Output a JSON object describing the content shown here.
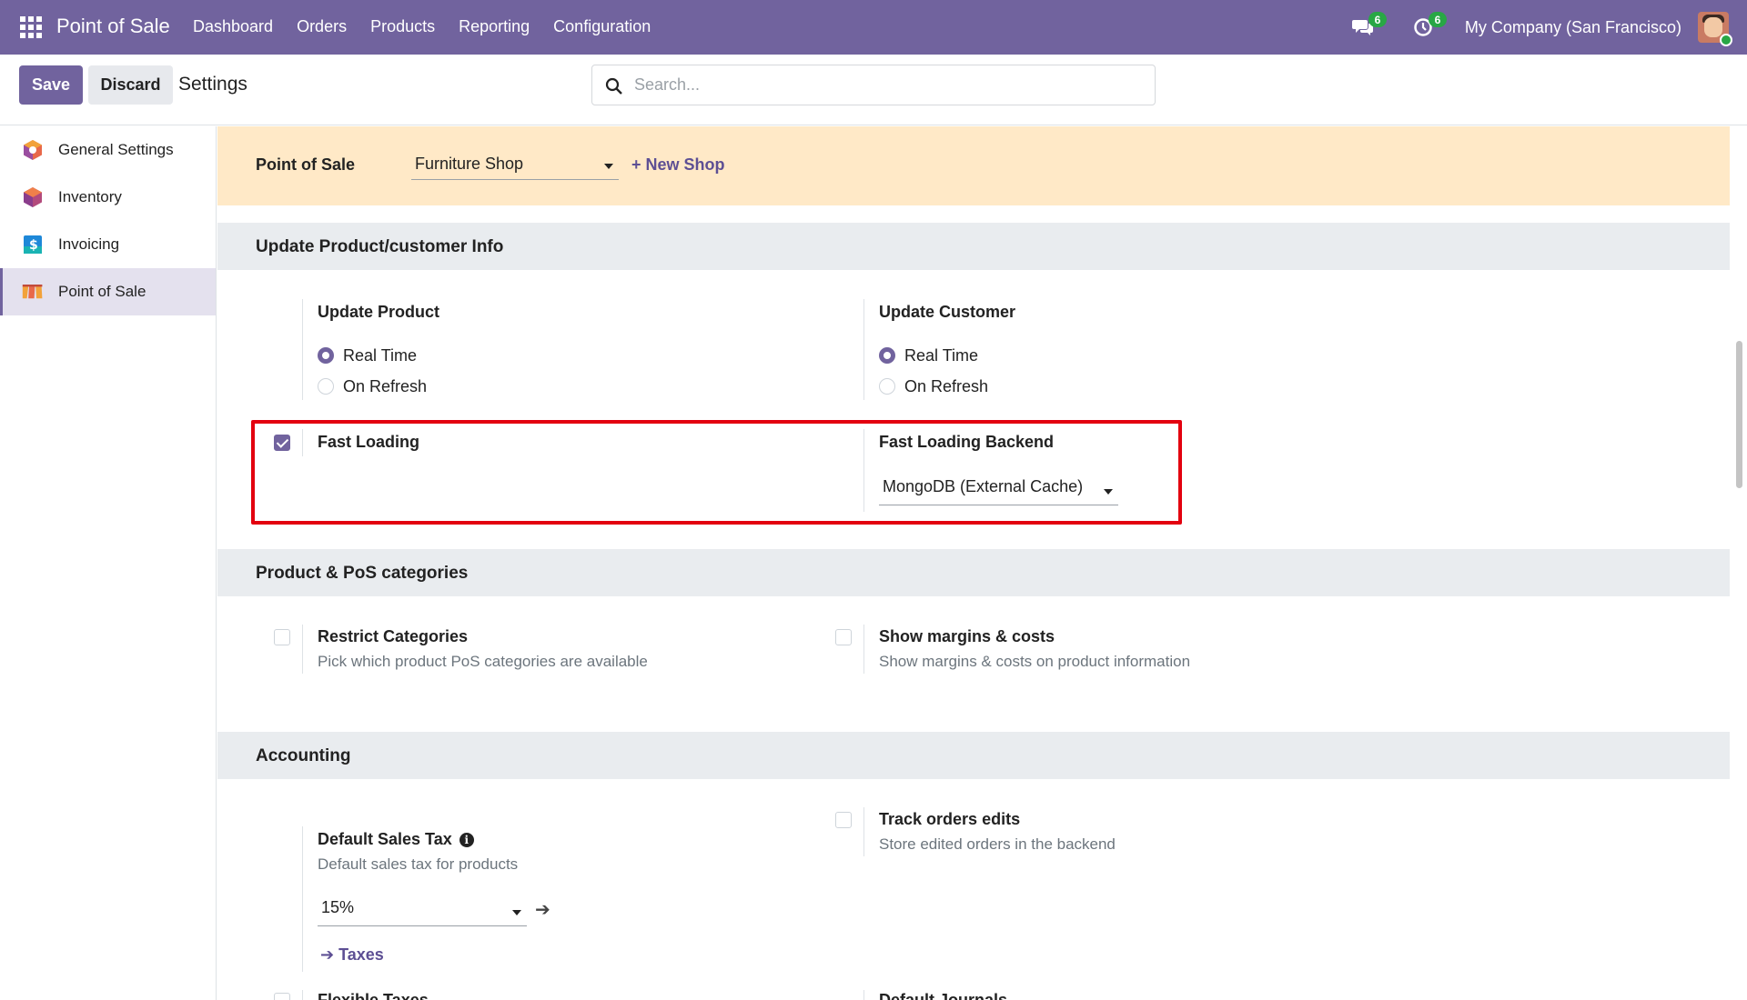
{
  "navbar": {
    "app_title": "Point of Sale",
    "menu": [
      "Dashboard",
      "Orders",
      "Products",
      "Reporting",
      "Configuration"
    ],
    "messages_count": "6",
    "activities_count": "6",
    "company": "My Company (San Francisco)"
  },
  "control": {
    "save_label": "Save",
    "discard_label": "Discard",
    "title": "Settings",
    "search_placeholder": "Search..."
  },
  "sidebar": {
    "items": [
      {
        "label": "General Settings",
        "icon": "general-settings-icon"
      },
      {
        "label": "Inventory",
        "icon": "inventory-icon"
      },
      {
        "label": "Invoicing",
        "icon": "invoicing-icon"
      },
      {
        "label": "Point of Sale",
        "icon": "point-of-sale-icon",
        "active": true
      }
    ]
  },
  "shop": {
    "label": "Point of Sale",
    "selected": "Furniture Shop",
    "new_shop": "+ New Shop"
  },
  "sections": {
    "update_info": {
      "title": "Update Product/customer Info",
      "update_product": {
        "title": "Update Product",
        "options": [
          "Real Time",
          "On Refresh"
        ],
        "selected": "Real Time"
      },
      "update_customer": {
        "title": "Update Customer",
        "options": [
          "Real Time",
          "On Refresh"
        ],
        "selected": "Real Time"
      },
      "fast_loading": {
        "title": "Fast Loading",
        "checked": true
      },
      "fast_loading_backend": {
        "title": "Fast Loading Backend",
        "value": "MongoDB (External Cache)"
      }
    },
    "categories": {
      "title": "Product & PoS categories",
      "restrict": {
        "title": "Restrict Categories",
        "desc": "Pick which product PoS categories are available",
        "checked": false
      },
      "margins": {
        "title": "Show margins & costs",
        "desc": "Show margins & costs on product information",
        "checked": false
      }
    },
    "accounting": {
      "title": "Accounting",
      "default_tax": {
        "title": "Default Sales Tax",
        "desc": "Default sales tax for products",
        "value": "15%",
        "link": "Taxes"
      },
      "track_edits": {
        "title": "Track orders edits",
        "desc": "Store edited orders in the backend",
        "checked": false
      },
      "flexible_taxes": {
        "title": "Flexible Taxes"
      },
      "default_journals": {
        "title": "Default Journals"
      }
    }
  },
  "colors": {
    "brand": "#71639e",
    "banner": "#ffe9c7",
    "highlight": "#e3000f",
    "badge": "#28a745"
  }
}
